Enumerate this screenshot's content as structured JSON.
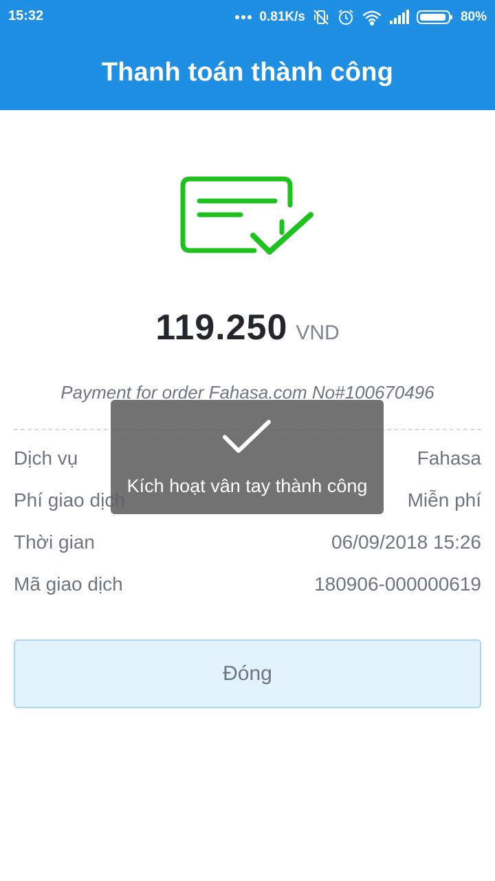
{
  "status_bar": {
    "time": "15:32",
    "more_icon": "more-dots-icon",
    "network_speed": "0.81K/s",
    "icons": [
      "vibrate-off-icon",
      "alarm-icon",
      "wifi-icon",
      "signal-icon",
      "battery-icon"
    ],
    "battery_percent": "80%"
  },
  "header": {
    "title": "Thanh toán thành công"
  },
  "result": {
    "icon": "payment-success-icon",
    "icon_color": "#1ec21e",
    "amount": "119.250",
    "currency": "VND",
    "description": "Payment for order Fahasa.com No#100670496"
  },
  "details": [
    {
      "label": "Dịch vụ",
      "value": "Fahasa"
    },
    {
      "label": "Phí giao dịch",
      "value": "Miễn phí"
    },
    {
      "label": "Thời gian",
      "value": "06/09/2018 15:26"
    },
    {
      "label": "Mã giao dịch",
      "value": "180906-000000619"
    }
  ],
  "close_button": {
    "label": "Đóng"
  },
  "toast": {
    "icon": "checkmark-icon",
    "message": "Kích hoạt vân tay thành công"
  },
  "colors": {
    "primary": "#1e8fe3",
    "success": "#1ec21e",
    "button_bg": "#e3f3fd",
    "button_border": "#a9d8f2"
  }
}
